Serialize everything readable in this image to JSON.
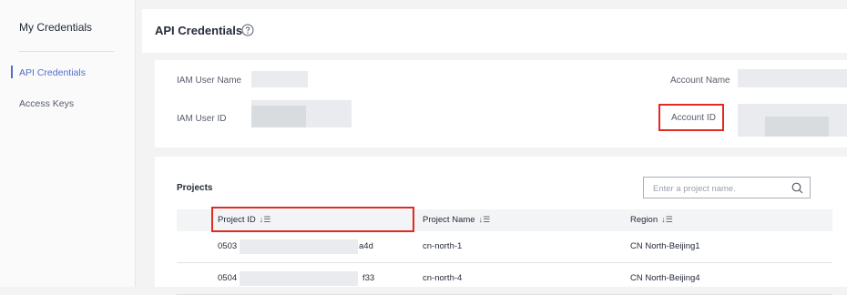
{
  "sidebar": {
    "title": "My Credentials",
    "items": [
      {
        "label": "API Credentials",
        "active": true
      },
      {
        "label": "Access Keys",
        "active": false
      }
    ]
  },
  "header": {
    "title": "API Credentials",
    "help_icon": "question-circle-icon"
  },
  "info": {
    "iam_user_name_label": "IAM User Name",
    "iam_user_id_label": "IAM User ID",
    "account_name_label": "Account Name",
    "account_id_label": "Account ID"
  },
  "projects": {
    "title": "Projects",
    "search_placeholder": "Enter a project name.",
    "columns": [
      "Project ID",
      "Project Name",
      "Region"
    ],
    "rows": [
      {
        "id_prefix": "0503",
        "id_suffix": "a4d",
        "name": "cn-north-1",
        "region": "CN North-Beijing1"
      },
      {
        "id_prefix": "0504",
        "id_suffix": "f33",
        "name": "cn-north-4",
        "region": "CN North-Beijing4"
      }
    ]
  },
  "colors": {
    "accent": "#526ecc",
    "highlight": "#e02a22",
    "blur": "#e9ebee"
  }
}
